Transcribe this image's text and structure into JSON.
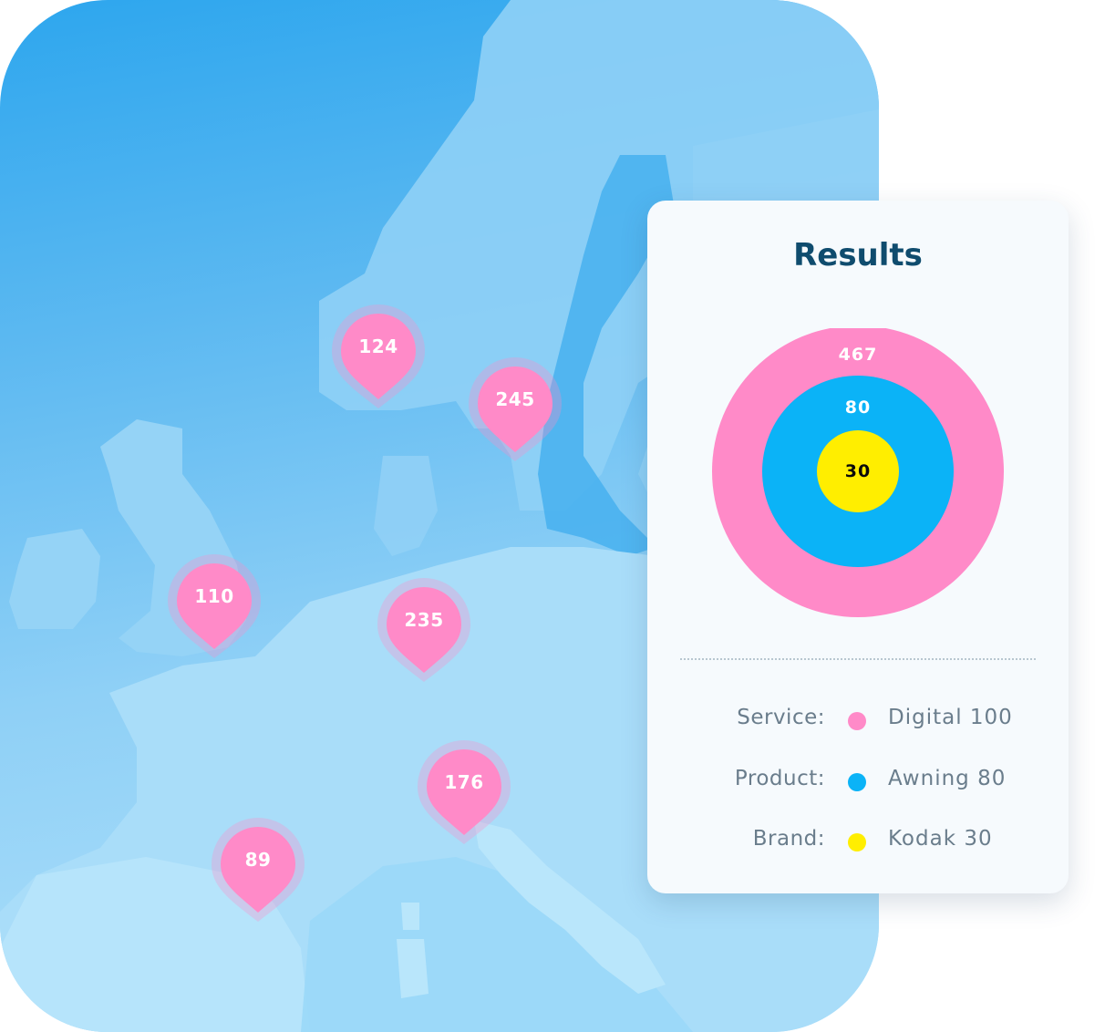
{
  "map": {
    "markers": [
      {
        "id": "norway",
        "value": "124"
      },
      {
        "id": "sweden",
        "value": "245"
      },
      {
        "id": "uk",
        "value": "110"
      },
      {
        "id": "germany",
        "value": "235"
      },
      {
        "id": "italy",
        "value": "176"
      },
      {
        "id": "spain",
        "value": "89"
      }
    ],
    "marker_color": "#ff8ac8",
    "land_color": "#9ad5f7",
    "sea_color": "#3aaaf0"
  },
  "results": {
    "title": "Results",
    "rings": {
      "outer": {
        "value": "467",
        "color": "#ff8ac8"
      },
      "middle": {
        "value": "80",
        "color": "#0bb3f7"
      },
      "inner": {
        "value": "30",
        "color": "#ffee00"
      }
    },
    "legend": [
      {
        "key": "Service:",
        "value": "Digital 100",
        "color": "#ff8ac8",
        "icon": "dot-icon"
      },
      {
        "key": "Product:",
        "value": "Awning 80",
        "color": "#0bb3f7",
        "icon": "dot-icon"
      },
      {
        "key": "Brand:",
        "value": "Kodak 30",
        "color": "#ffee00",
        "icon": "dot-icon"
      }
    ]
  }
}
